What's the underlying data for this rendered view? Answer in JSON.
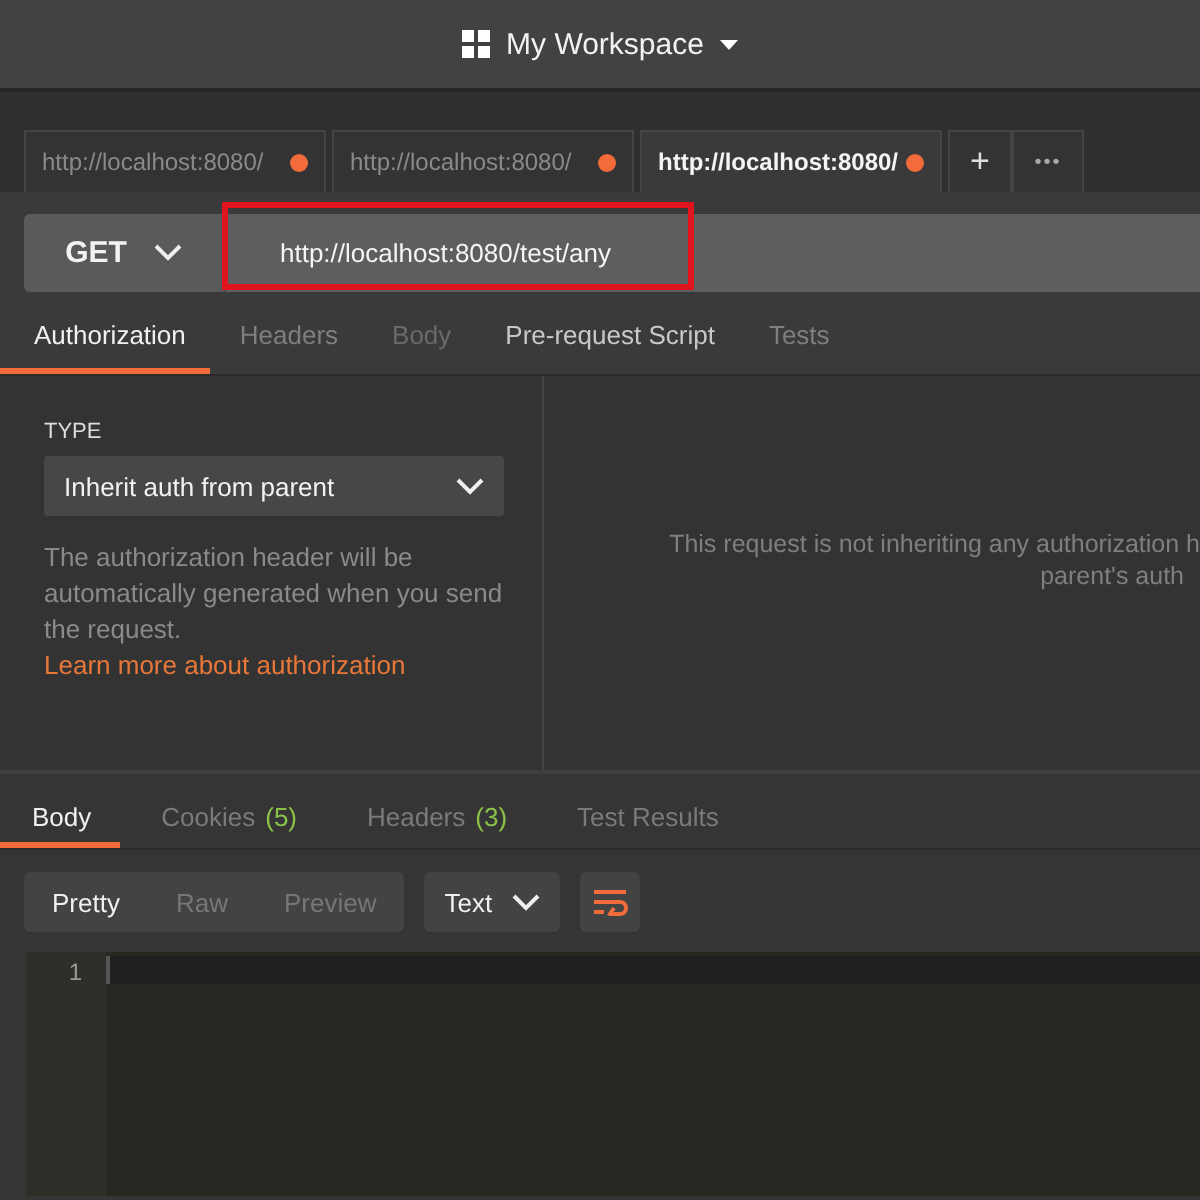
{
  "workspace": {
    "title": "My Workspace"
  },
  "tabs": [
    {
      "label": "http://localhost:8080/",
      "selected": false,
      "unsaved": true
    },
    {
      "label": "http://localhost:8080/",
      "selected": false,
      "unsaved": true
    },
    {
      "label": "http://localhost:8080/",
      "selected": true,
      "unsaved": true
    }
  ],
  "tab_actions": {
    "new": "+",
    "more": "•••"
  },
  "request": {
    "method": "GET",
    "url": "http://localhost:8080/test/any"
  },
  "request_tabs": [
    {
      "label": "Authorization",
      "selected": true,
      "disabled": false,
      "has_content": false
    },
    {
      "label": "Headers",
      "selected": false,
      "disabled": false,
      "has_content": false
    },
    {
      "label": "Body",
      "selected": false,
      "disabled": true,
      "has_content": false
    },
    {
      "label": "Pre-request Script",
      "selected": false,
      "disabled": false,
      "has_content": true
    },
    {
      "label": "Tests",
      "selected": false,
      "disabled": false,
      "has_content": false
    }
  ],
  "auth": {
    "type_label": "TYPE",
    "type_value": "Inherit auth from parent",
    "description": "The authorization header will be automatically generated when you send the request.",
    "link": "Learn more about authorization",
    "message_lines": [
      "This request is not inheriting any authorization h",
      "parent's auth"
    ]
  },
  "response_tabs": [
    {
      "label": "Body",
      "selected": true
    },
    {
      "label": "Cookies",
      "count": "(5)",
      "selected": false
    },
    {
      "label": "Headers",
      "count": "(3)",
      "selected": false
    },
    {
      "label": "Test Results",
      "selected": false
    }
  ],
  "view_modes": [
    {
      "label": "Pretty",
      "selected": true
    },
    {
      "label": "Raw",
      "selected": false
    },
    {
      "label": "Preview",
      "selected": false
    }
  ],
  "format": "Text",
  "wrap_lines": true,
  "editor": {
    "line_numbers": [
      "1"
    ]
  }
}
